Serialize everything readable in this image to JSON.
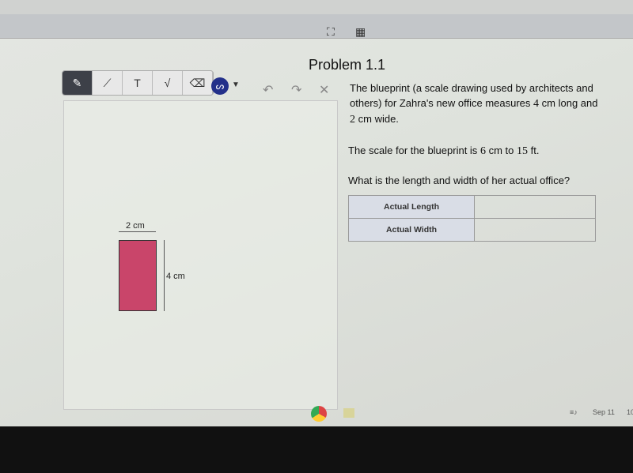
{
  "top_toolbar": {
    "icons": [
      "fullscreen-icon",
      "calculator-icon"
    ]
  },
  "drawing_tools": {
    "tools": [
      "pencil-icon",
      "line-icon",
      "T",
      "√",
      "eraser-icon"
    ],
    "color": "#23308a",
    "actions": [
      "undo-icon",
      "redo-icon",
      "close-icon"
    ]
  },
  "problem": {
    "title": "Problem 1.1",
    "p1": "The blueprint (a scale drawing used by architects and others) for Zahra's new office measures",
    "p1_len": "4",
    "p1_mid": "cm long and",
    "p1_wid": "2",
    "p1_end": "cm wide.",
    "p2_pre": "The scale for the blueprint is",
    "p2_a": "6",
    "p2_mid": "cm to",
    "p2_b": "15",
    "p2_end": "ft.",
    "question": "What is the length and width of her actual office?",
    "table": [
      {
        "label": "Actual Length",
        "value": ""
      },
      {
        "label": "Actual Width",
        "value": ""
      }
    ]
  },
  "figure": {
    "width_label": "2 cm",
    "length_label": "4 cm",
    "fill": "#c9456a"
  },
  "shelf": {
    "date": "Sep 11",
    "time": "10"
  }
}
